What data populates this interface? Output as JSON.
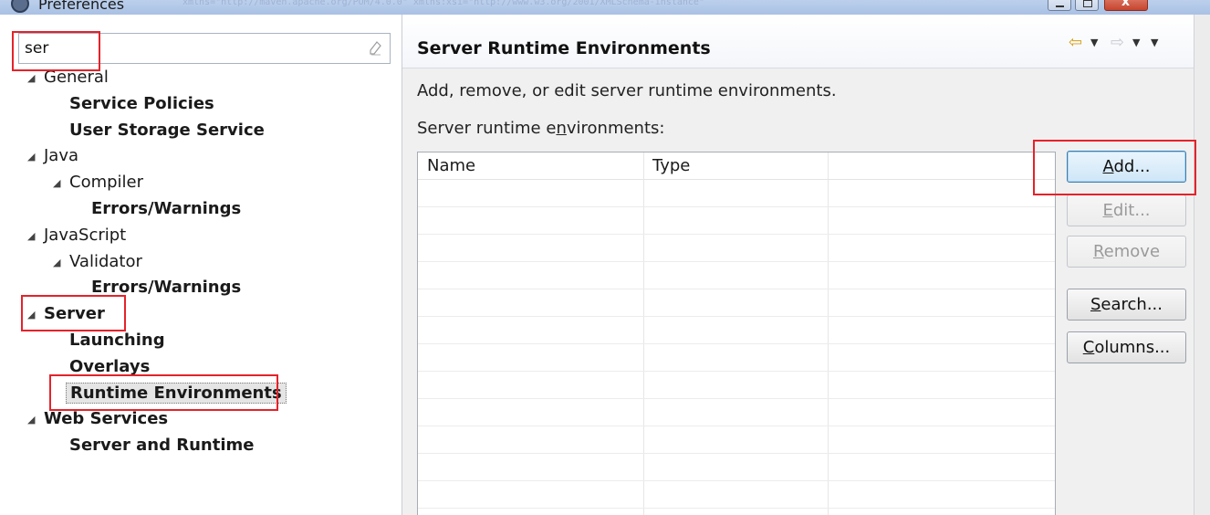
{
  "window": {
    "title": "Preferences"
  },
  "filter": {
    "value": "ser",
    "placeholder": ""
  },
  "tree": [
    {
      "label": "General",
      "level": 0,
      "expanded": true,
      "bold": false
    },
    {
      "label": "Service Policies",
      "level": 1,
      "bold": true
    },
    {
      "label": "User Storage Service",
      "level": 1,
      "bold": true
    },
    {
      "label": "Java",
      "level": 0,
      "expanded": true,
      "bold": false
    },
    {
      "label": "Compiler",
      "level": 1,
      "expanded": true,
      "bold": false
    },
    {
      "label": "Errors/Warnings",
      "level": 2,
      "bold": true
    },
    {
      "label": "JavaScript",
      "level": 0,
      "expanded": true,
      "bold": false
    },
    {
      "label": "Validator",
      "level": 1,
      "expanded": true,
      "bold": false
    },
    {
      "label": "Errors/Warnings",
      "level": 2,
      "bold": true
    },
    {
      "label": "Server",
      "level": 0,
      "expanded": true,
      "bold": true
    },
    {
      "label": "Launching",
      "level": 1,
      "bold": true
    },
    {
      "label": "Overlays",
      "level": 1,
      "bold": true
    },
    {
      "label": "Runtime Environments",
      "level": 1,
      "bold": true,
      "selected": true
    },
    {
      "label": "Web Services",
      "level": 0,
      "expanded": true,
      "bold": true
    },
    {
      "label": "Server and Runtime",
      "level": 1,
      "bold": true
    }
  ],
  "page": {
    "title": "Server Runtime Environments",
    "description": "Add, remove, or edit server runtime environments.",
    "table_label_pre": "Server runtime e",
    "table_label_mnemonic": "n",
    "table_label_post": "vironments:"
  },
  "table": {
    "columns": [
      "Name",
      "Type",
      ""
    ],
    "rows": []
  },
  "buttons": {
    "add": {
      "mnemonic": "A",
      "rest": "dd...",
      "enabled": true
    },
    "edit": {
      "mnemonic": "E",
      "rest": "dit...",
      "enabled": false
    },
    "remove": {
      "mnemonic": "R",
      "rest": "emove",
      "enabled": false
    },
    "search": {
      "mnemonic": "S",
      "rest": "earch...",
      "enabled": true
    },
    "columns": {
      "mnemonic": "C",
      "rest": "olumns...",
      "enabled": true
    }
  },
  "colors": {
    "highlight": "#e5222a",
    "nav_arrow": "#d4a017"
  },
  "icons": {
    "back": "back-arrow-icon",
    "forward": "forward-arrow-icon",
    "clear": "clear-filter-icon",
    "app": "preferences-app-icon"
  }
}
